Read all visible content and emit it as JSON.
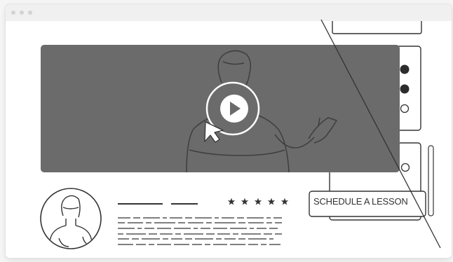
{
  "window": {
    "controls": [
      "close",
      "minimize",
      "maximize"
    ]
  },
  "video": {
    "play_icon": "play-icon",
    "cursor_icon": "cursor-arrow-icon"
  },
  "instructor": {
    "avatar_icon": "instructor-avatar",
    "rating": 5,
    "rating_max": 5
  },
  "actions": {
    "cta_label": "SCHEDULE A LESSON"
  },
  "colors": {
    "video_bg": "#6b6b6b",
    "outline": "#333333",
    "page_bg": "#ffffff"
  }
}
